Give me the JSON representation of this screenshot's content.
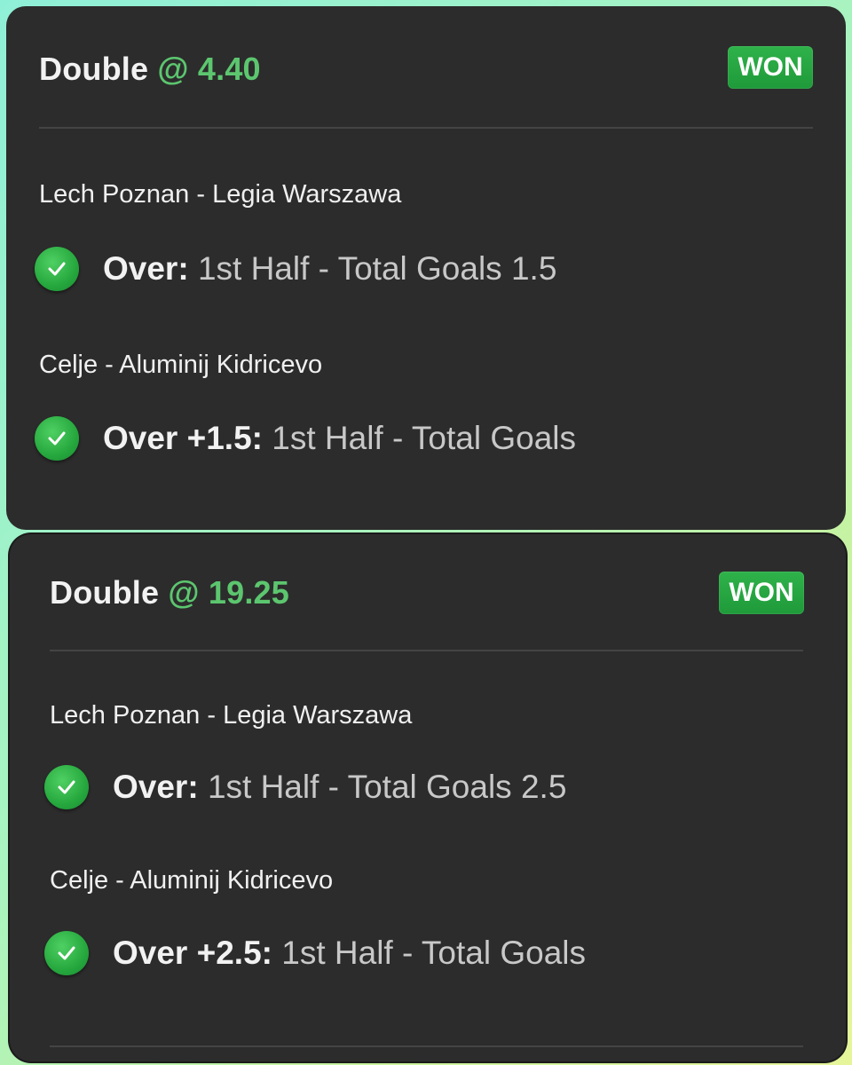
{
  "slips": [
    {
      "title": "Double",
      "odds": "@ 4.40",
      "status": "WON",
      "legs": [
        {
          "match": "Lech Poznan - Legia Warszawa",
          "selection": "Over:",
          "market": "1st Half - Total Goals 1.5",
          "icon": "check-circle-icon"
        },
        {
          "match": "Celje - Aluminij Kidricevo",
          "selection": "Over +1.5:",
          "market": "1st Half - Total Goals",
          "icon": "check-circle-icon"
        }
      ]
    },
    {
      "title": "Double",
      "odds": "@ 19.25",
      "status": "WON",
      "legs": [
        {
          "match": "Lech Poznan - Legia Warszawa",
          "selection": "Over:",
          "market": "1st Half - Total Goals 2.5",
          "icon": "check-circle-icon"
        },
        {
          "match": "Celje - Aluminij Kidricevo",
          "selection": "Over +2.5:",
          "market": "1st Half - Total Goals",
          "icon": "check-circle-icon"
        }
      ]
    }
  ],
  "colors": {
    "card_background": "#2c2c2c",
    "odds_green": "#5cc66f",
    "won_badge_green": "#26a83e",
    "market_text": "#c8c8c8"
  }
}
